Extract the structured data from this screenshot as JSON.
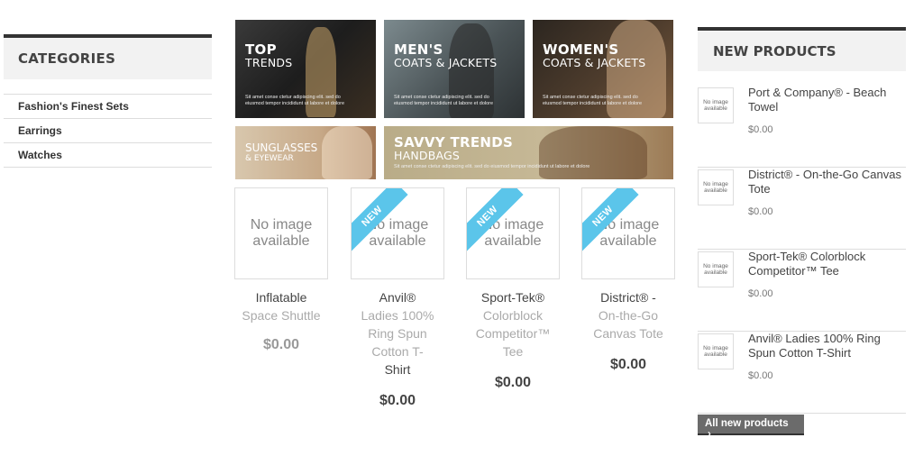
{
  "categories": {
    "title": "CATEGORIES",
    "items": [
      "Fashion's Finest Sets",
      "Earrings",
      "Watches"
    ]
  },
  "banners": {
    "top": {
      "line1": "TOP",
      "line2": "TRENDS",
      "desc": "Sit amet conse ctetur adipiscing elit. sed do eiusmod tempor incididunt ut labore et dolore"
    },
    "men": {
      "line1": "MEN'S",
      "line2": "COATS & JACKETS",
      "desc": "Sit amet conse ctetur adipiscing elit. sed do eiusmod tempor incididunt ut labore et dolore"
    },
    "women": {
      "line1": "WOMEN'S",
      "line2": "COATS & JACKETS",
      "desc": "Sit amet conse ctetur adipiscing elit. sed do eiusmod tempor incididunt ut labore et dolore"
    },
    "sunglasses": {
      "line1": "SUNGLASSES",
      "line2": "& EYEWEAR"
    },
    "savvy": {
      "line1": "SAVVY TRENDS",
      "line2": "HANDBAGS",
      "desc": "Sit amet conse ctetur adipiscing elit. sed do eiusmod tempor incididunt ut labore et dolore"
    }
  },
  "products": [
    {
      "img_text": "No image available",
      "ribbon": "",
      "name_first": "Inflatable",
      "name_rest": "Space Shuttle",
      "price": "$0.00"
    },
    {
      "img_text": "No image available",
      "ribbon": "NEW",
      "name_first": "Anvil®",
      "name_rest": "Ladies 100% Ring Spun Cotton T-",
      "name_last": "Shirt",
      "price": "$0.00"
    },
    {
      "img_text": "No image available",
      "ribbon": "NEW",
      "name_first": "Sport-Tek®",
      "name_rest": "Colorblock Competitor™ Tee",
      "price": "$0.00"
    },
    {
      "img_text": "No image available",
      "ribbon": "NEW",
      "name_first": "District® -",
      "name_rest": "On-the-Go Canvas Tote",
      "price": "$0.00"
    }
  ],
  "new_products": {
    "title": "NEW PRODUCTS",
    "thumb_text": "No image available",
    "items": [
      {
        "name": "Port & Company® - Beach Towel",
        "price": "$0.00"
      },
      {
        "name": "District® - On-the-Go Canvas Tote",
        "price": "$0.00"
      },
      {
        "name": "Sport-Tek® Colorblock Competitor™ Tee",
        "price": "$0.00"
      },
      {
        "name": "Anvil® Ladies 100% Ring Spun Cotton T-Shirt",
        "price": "$0.00"
      }
    ],
    "all_button": "All new products"
  },
  "colors": {
    "ribbon": "#5bc5ea",
    "heading_border": "#333333",
    "button_bg": "#6b6b6b"
  }
}
